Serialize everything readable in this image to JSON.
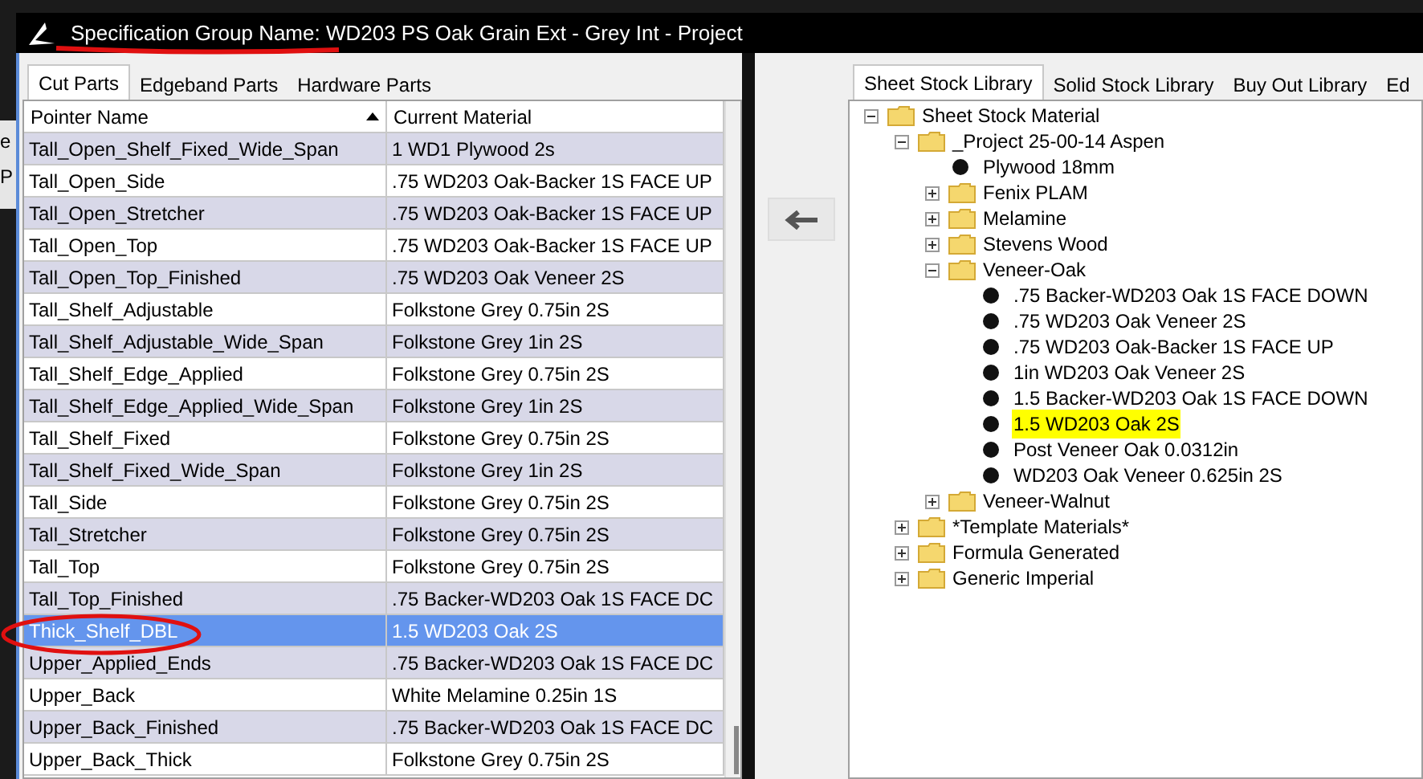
{
  "background_window": {
    "texts": [
      "e",
      "P"
    ]
  },
  "window": {
    "title": "Specification Group Name: WD203 PS Oak Grain Ext - Grey Int - Project"
  },
  "left_tabs": [
    {
      "label": "Cut Parts",
      "selected": true
    },
    {
      "label": "Edgeband Parts",
      "selected": false
    },
    {
      "label": "Hardware Parts",
      "selected": false
    }
  ],
  "table": {
    "columns": [
      {
        "label": "Pointer Name",
        "sorted": true
      },
      {
        "label": "Current Material",
        "sorted": false
      }
    ],
    "rows": [
      {
        "name": "Tall_Open_Shelf_Fixed_Wide_Span",
        "material": "1 WD1 Plywood 2s",
        "selected": false
      },
      {
        "name": "Tall_Open_Side",
        "material": ".75 WD203 Oak-Backer 1S FACE UP",
        "selected": false
      },
      {
        "name": "Tall_Open_Stretcher",
        "material": ".75 WD203 Oak-Backer 1S FACE UP",
        "selected": false
      },
      {
        "name": "Tall_Open_Top",
        "material": ".75 WD203 Oak-Backer 1S FACE UP",
        "selected": false
      },
      {
        "name": "Tall_Open_Top_Finished",
        "material": ".75 WD203 Oak Veneer 2S",
        "selected": false
      },
      {
        "name": "Tall_Shelf_Adjustable",
        "material": "Folkstone Grey 0.75in 2S",
        "selected": false
      },
      {
        "name": "Tall_Shelf_Adjustable_Wide_Span",
        "material": "Folkstone Grey 1in 2S",
        "selected": false
      },
      {
        "name": "Tall_Shelf_Edge_Applied",
        "material": "Folkstone Grey 0.75in 2S",
        "selected": false
      },
      {
        "name": "Tall_Shelf_Edge_Applied_Wide_Span",
        "material": "Folkstone Grey 1in 2S",
        "selected": false
      },
      {
        "name": "Tall_Shelf_Fixed",
        "material": "Folkstone Grey 0.75in 2S",
        "selected": false
      },
      {
        "name": "Tall_Shelf_Fixed_Wide_Span",
        "material": "Folkstone Grey 1in 2S",
        "selected": false
      },
      {
        "name": "Tall_Side",
        "material": "Folkstone Grey 0.75in 2S",
        "selected": false
      },
      {
        "name": "Tall_Stretcher",
        "material": "Folkstone Grey 0.75in 2S",
        "selected": false
      },
      {
        "name": "Tall_Top",
        "material": "Folkstone Grey 0.75in 2S",
        "selected": false
      },
      {
        "name": "Tall_Top_Finished",
        "material": ".75 Backer-WD203 Oak 1S FACE DC",
        "selected": false
      },
      {
        "name": "Thick_Shelf_DBL",
        "material": "1.5 WD203 Oak 2S",
        "selected": true
      },
      {
        "name": "Upper_Applied_Ends",
        "material": ".75 Backer-WD203 Oak 1S FACE DC",
        "selected": false
      },
      {
        "name": "Upper_Back",
        "material": "White Melamine 0.25in 1S",
        "selected": false
      },
      {
        "name": "Upper_Back_Finished",
        "material": ".75 Backer-WD203 Oak 1S FACE DC",
        "selected": false
      },
      {
        "name": "Upper_Back_Thick",
        "material": "Folkstone Grey 0.75in 2S",
        "selected": false
      }
    ]
  },
  "right_tabs": [
    {
      "label": "Sheet Stock Library",
      "selected": true
    },
    {
      "label": "Solid Stock Library",
      "selected": false
    },
    {
      "label": "Buy Out Library",
      "selected": false
    },
    {
      "label": "Ed",
      "selected": false
    }
  ],
  "tree": [
    {
      "kind": "folder",
      "label": "Sheet Stock Material",
      "expanded": true,
      "children": [
        {
          "kind": "folder",
          "label": "_Project 25-00-14 Aspen",
          "expanded": true,
          "children": [
            {
              "kind": "material",
              "label": "Plywood 18mm",
              "highlighted": false
            },
            {
              "kind": "folder",
              "label": "Fenix PLAM",
              "expanded": false
            },
            {
              "kind": "folder",
              "label": "Melamine",
              "expanded": false
            },
            {
              "kind": "folder",
              "label": "Stevens Wood",
              "expanded": false
            },
            {
              "kind": "folder",
              "label": "Veneer-Oak",
              "expanded": true,
              "children": [
                {
                  "kind": "material",
                  "label": ".75 Backer-WD203 Oak 1S FACE DOWN",
                  "highlighted": false
                },
                {
                  "kind": "material",
                  "label": ".75 WD203 Oak Veneer 2S",
                  "highlighted": false
                },
                {
                  "kind": "material",
                  "label": ".75 WD203 Oak-Backer 1S FACE UP",
                  "highlighted": false
                },
                {
                  "kind": "material",
                  "label": "1in WD203 Oak Veneer 2S",
                  "highlighted": false
                },
                {
                  "kind": "material",
                  "label": "1.5 Backer-WD203 Oak 1S FACE DOWN",
                  "highlighted": false
                },
                {
                  "kind": "material",
                  "label": "1.5 WD203 Oak 2S",
                  "highlighted": true
                },
                {
                  "kind": "material",
                  "label": "Post Veneer Oak 0.0312in",
                  "highlighted": false
                },
                {
                  "kind": "material",
                  "label": "WD203 Oak Veneer 0.625in 2S",
                  "highlighted": false
                }
              ]
            },
            {
              "kind": "folder",
              "label": "Veneer-Walnut",
              "expanded": false
            }
          ]
        },
        {
          "kind": "folder",
          "label": "*Template Materials*",
          "expanded": false
        },
        {
          "kind": "folder",
          "label": "Formula Generated",
          "expanded": false
        },
        {
          "kind": "folder",
          "label": "Generic Imperial",
          "expanded": false
        }
      ]
    }
  ]
}
